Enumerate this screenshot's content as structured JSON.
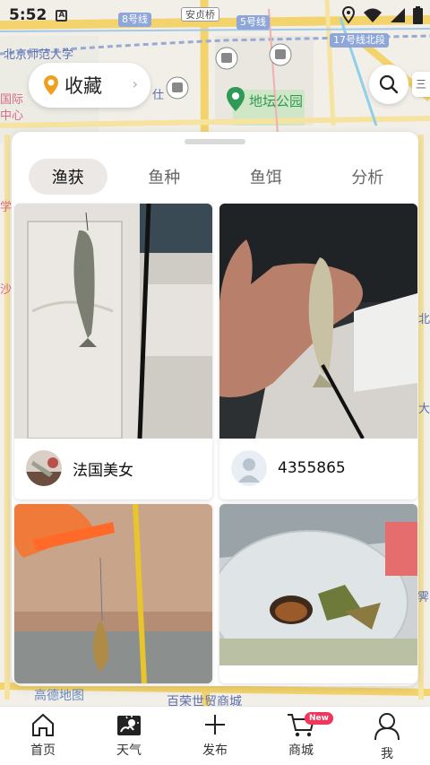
{
  "status_bar": {
    "time": "5:52",
    "notif_letter": "A"
  },
  "map": {
    "labels": {
      "bnu": "北京师范大学",
      "ditan": "地坛公园",
      "anzhenqiao": "安贞桥",
      "line8": "8号线",
      "line5": "5号线",
      "line17": "17号线北段",
      "guoji": "国际",
      "zhongxin": "中心",
      "shi": "仕",
      "gaode": "高德地图",
      "baihuo": "百荣世贸商城",
      "bei": "北",
      "da": "大",
      "shao": "沙",
      "xue": "学",
      "jiao": "霁"
    }
  },
  "favorites": {
    "label": "收藏"
  },
  "layer_chip": "三",
  "tabs": [
    {
      "label": "渔获",
      "active": true
    },
    {
      "label": "鱼种",
      "active": false
    },
    {
      "label": "鱼饵",
      "active": false
    },
    {
      "label": "分析",
      "active": false
    }
  ],
  "posts": [
    {
      "user": "法国美女"
    },
    {
      "user": "4355865"
    },
    {
      "user": ""
    },
    {
      "user": ""
    }
  ],
  "nav": [
    {
      "label": "首页",
      "icon": "home-icon"
    },
    {
      "label": "天气",
      "icon": "weather-icon"
    },
    {
      "label": "发布",
      "icon": "plus-icon"
    },
    {
      "label": "商城",
      "icon": "cart-icon",
      "badge": "New"
    },
    {
      "label": "我",
      "icon": "profile-icon"
    }
  ],
  "colors": {
    "accent_badge": "#f0365a",
    "map_pin": "#f0a020",
    "park_green": "#2f9a55",
    "road_yellow": "#f3d36b"
  }
}
